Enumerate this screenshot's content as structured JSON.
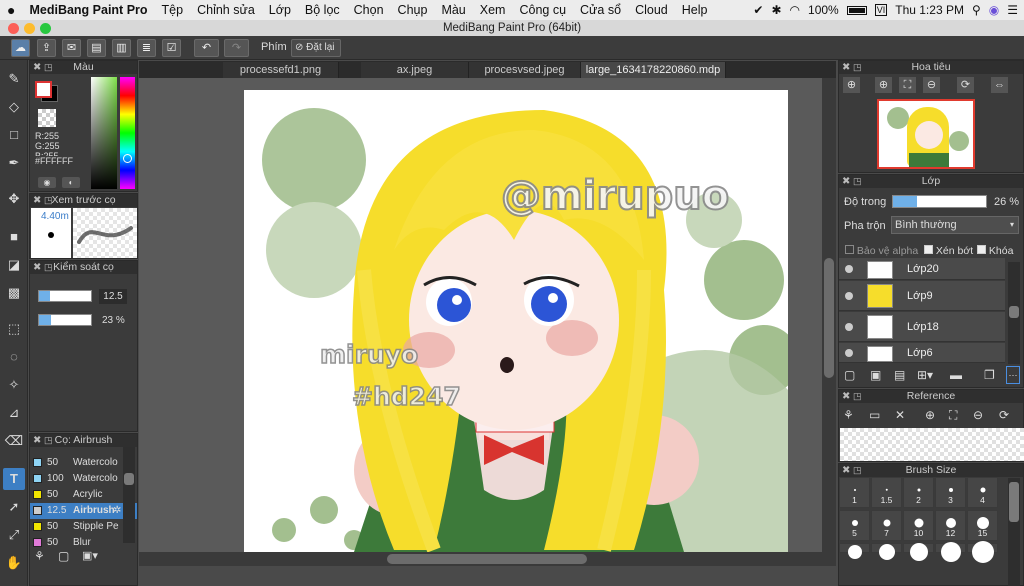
{
  "menubar": {
    "apple": "",
    "app_name": "MediBang Paint Pro",
    "items": [
      "Tệp",
      "Chỉnh sửa",
      "Lớp",
      "Bộ lọc",
      "Chọn",
      "Chụp",
      "Màu",
      "Xem",
      "Công cụ",
      "Cửa sổ",
      "Cloud",
      "Help"
    ],
    "battery": "100%",
    "clock": "Thu 1:23 PM"
  },
  "window": {
    "title": "MediBang Paint Pro (64bit)"
  },
  "toolbar": {
    "shortcut_label": "Phím",
    "reset_label": "Đặt lại"
  },
  "tabs": [
    "processefd1.png",
    "ax.jpeg",
    "procesvsed.jpeg",
    "large_1634178220860.mdp"
  ],
  "color_panel": {
    "title": "Màu",
    "r": "R:255",
    "g": "G:255",
    "b": "B:255",
    "hex": "#FFFFFF",
    "fg": "#ffffff",
    "bg": "#000000"
  },
  "brush_preview": {
    "title": "Xem trước cọ",
    "size": "4.40m"
  },
  "brush_control": {
    "title": "Kiểm soát cọ",
    "size_value": "12.5",
    "opacity_value": "23 %"
  },
  "brush_list": {
    "title": "Cọ: Airbrush",
    "items": [
      {
        "size": "50",
        "name": "Watercolo",
        "color": "#8fd4f4"
      },
      {
        "size": "100",
        "name": "Watercolo",
        "color": "#8fd4f4"
      },
      {
        "size": "50",
        "name": "Acrylic",
        "color": "#f2e600"
      },
      {
        "size": "12.5",
        "name": "Airbrush",
        "color": "#cccccc"
      },
      {
        "size": "50",
        "name": "Stipple Pe",
        "color": "#f2e600"
      },
      {
        "size": "50",
        "name": "Blur",
        "color": "#e07ad8"
      }
    ]
  },
  "navigator": {
    "title": "Hoa tiêu"
  },
  "layer_panel": {
    "title": "Lớp",
    "opacity_label": "Độ trong",
    "opacity_value": "26 %",
    "opacity_fraction": 0.26,
    "blend_label": "Pha trộn",
    "blend_value": "Bình thường",
    "protect_alpha": "Bảo vệ alpha",
    "clipping": "Xén bớt",
    "lock": "Khóa",
    "layers": [
      "Lớp20",
      "Lớp9",
      "Lớp18",
      "Lớp6"
    ]
  },
  "reference": {
    "title": "Reference"
  },
  "brush_size": {
    "title": "Brush Size",
    "sizes": [
      "1",
      "1.5",
      "2",
      "3",
      "4",
      "5",
      "7",
      "10",
      "12",
      "15"
    ]
  },
  "artwork": {
    "watermark_main": "@mirupuo",
    "watermark_sub1": "miruyo",
    "watermark_sub2": "#hd247"
  }
}
